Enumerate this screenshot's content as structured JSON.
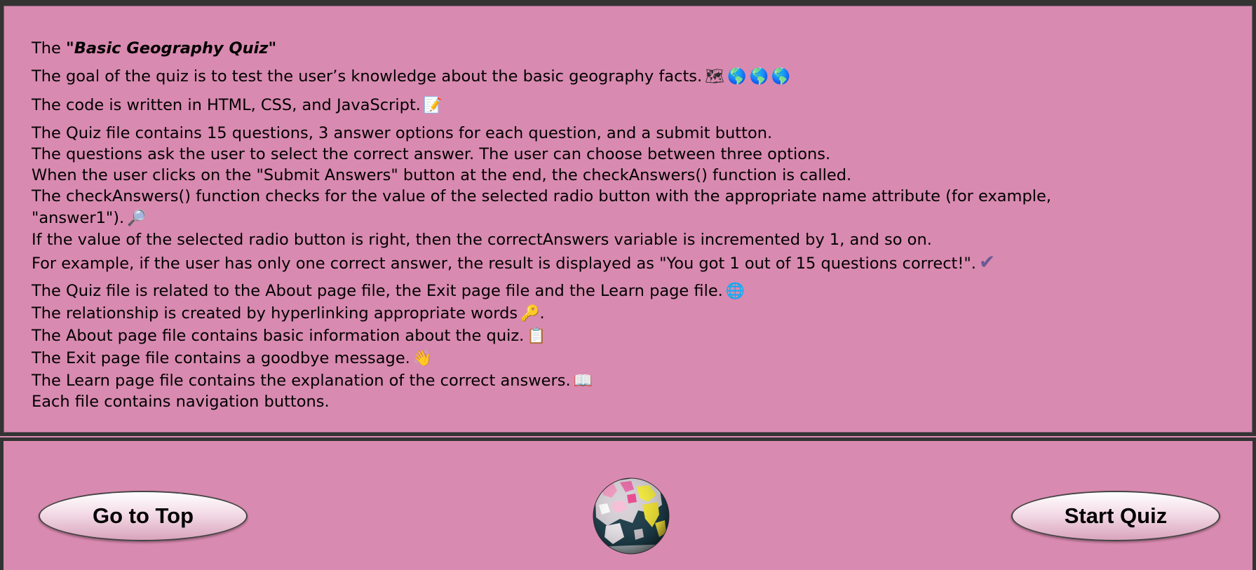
{
  "info": {
    "title_prefix": "The ",
    "title_quoted": "\"Basic Geography Quiz\"",
    "line_goal": "The goal of the quiz is to test the user’s knowledge about the basic geography facts.",
    "line_code": "The code is written in HTML, CSS, and JavaScript.",
    "line_file": "The Quiz file contains 15 questions, 3 answer options for each question, and a submit button.",
    "line_select": "The questions ask the user to select the correct answer. The user can choose between three options.",
    "line_submit": "When the user clicks on the \"Submit Answers\" button at the end, the checkAnswers() function is called.",
    "line_check_1": "The checkAnswers() function checks for the value of the selected radio button with the appropriate name attribute (for example,",
    "line_check_2": "\"answer1\").",
    "line_increment": "If the value of the selected radio button is right, then the correctAnswers variable is incremented by 1, and so on.",
    "line_example": "For example, if the user has only one correct answer, the result is displayed as \"You got 1 out of 15 questions correct!\".",
    "line_related": "The Quiz file is related to the About page file, the Exit page file and the Learn page file.",
    "line_relationship": "The relationship is created by hyperlinking appropriate words",
    "line_about": "The About page file contains basic information about the quiz.",
    "line_exit": "The Exit page file contains a goodbye message.",
    "line_learn": "The Learn page file contains the explanation of the correct answers.",
    "line_nav": "Each file contains navigation buttons."
  },
  "emojis": {
    "map": "🗺",
    "globe": "🌎",
    "memo": "📝",
    "search": "🔎",
    "check": "✔",
    "web": "🌐",
    "key": "🔑",
    "clipboard": "📋",
    "wave": "👋",
    "book": "📖",
    "period": "."
  },
  "footer": {
    "top_button": "Go to Top",
    "start_button": "Start Quiz"
  },
  "icons": [
    "world-map-icon",
    "globe-icon",
    "memo-icon",
    "magnifier-icon",
    "check-icon",
    "web-globe-icon",
    "key-icon",
    "clipboard-icon",
    "waving-hand-icon",
    "open-book-icon",
    "rotating-earth-icon"
  ],
  "colors": {
    "background": "#d98ab0",
    "border": "#333333",
    "button_gradient_top": "#ffffff",
    "button_gradient_bottom": "#d9a4bd"
  }
}
